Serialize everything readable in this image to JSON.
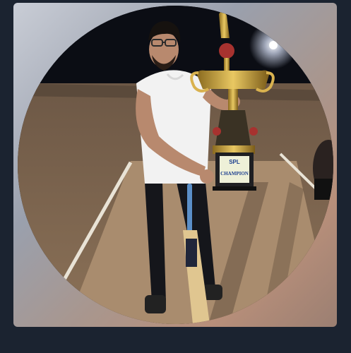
{
  "trophy": {
    "logo_text": "SPL",
    "plate_text": "CHAMPION"
  },
  "colors": {
    "background": "#1b2330",
    "frame_gradient": [
      "#c9cdd6",
      "#9aa0ad",
      "#b88f7a",
      "#9b7f72"
    ]
  }
}
